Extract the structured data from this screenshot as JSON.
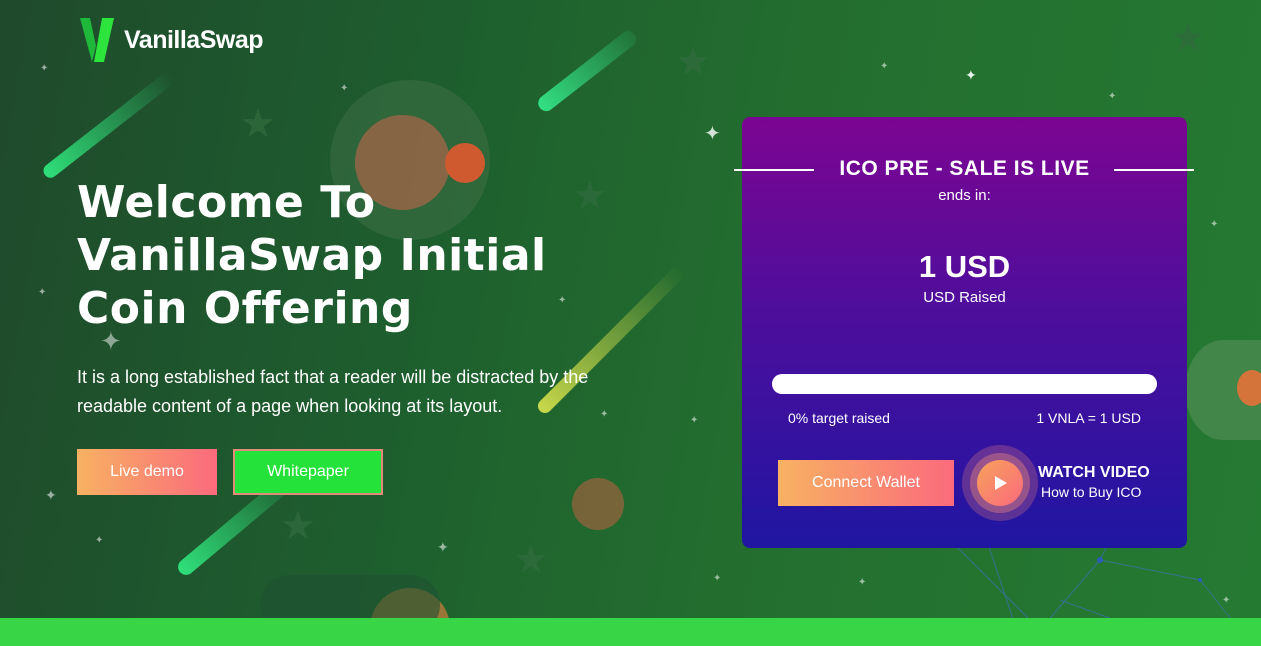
{
  "brand": {
    "name": "VanillaSwap",
    "logo_icon": "v-logo-icon",
    "accent_green": "#2de43c"
  },
  "hero": {
    "title": "Welcome To VanillaSwap Initial Coin Offering",
    "description": "It is a long established fact that a reader will be distracted by the readable content of a page when looking at its layout.",
    "live_demo_label": "Live demo",
    "whitepaper_label": "Whitepaper"
  },
  "ico_card": {
    "title": "ICO PRE - SALE IS LIVE",
    "ends_label": "ends in:",
    "amount": "1 USD",
    "amount_label": "USD Raised",
    "progress_fraction": 0,
    "target_text": "0% target raised",
    "rate_text": "1 VNLA = 1 USD",
    "connect_label": "Connect Wallet",
    "watch_title": "WATCH VIDEO",
    "watch_subtitle": "How to Buy ICO",
    "play_icon": "play-icon"
  },
  "colors": {
    "button_gradient_start": "#f7b262",
    "button_gradient_end": "#fb6a7d",
    "whitepaper_bg": "#25e23a",
    "card_top": "#7c0592",
    "card_bottom": "#1f16a2"
  }
}
